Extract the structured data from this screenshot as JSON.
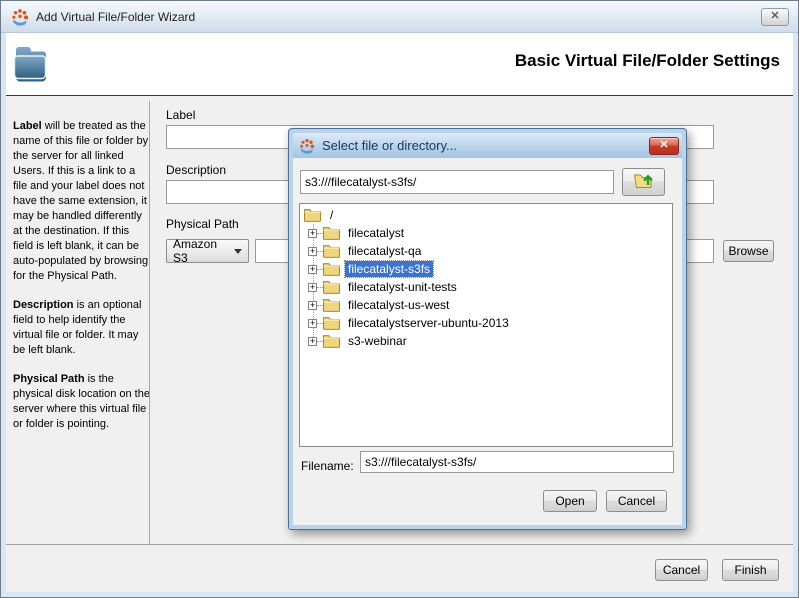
{
  "window": {
    "title": "Add Virtual File/Folder Wizard",
    "close_glyph": "✕"
  },
  "header": {
    "title": "Basic Virtual File/Folder Settings"
  },
  "sidebar": {
    "paragraphs": [
      {
        "lead": "Label",
        "rest": " will be treated as the name of this file or folder by the server for all linked Users. If this is a link to a file and your label does not have the same extension, it may be handled differently at the destination. If this field is left blank, it can be auto-populated by browsing for the Physical Path."
      },
      {
        "lead": "Description",
        "rest": " is an optional field to help identify the virtual file or folder. It may be left blank."
      },
      {
        "lead": "Physical Path",
        "rest": " is the physical disk location on the server where this virtual file or folder is pointing."
      }
    ]
  },
  "form": {
    "label_label": "Label",
    "label_value": "",
    "description_label": "Description",
    "description_value": "",
    "physical_path_label": "Physical Path",
    "storage_type_selected": "Amazon S3",
    "physical_path_value": "",
    "browse_label": "Browse"
  },
  "footer": {
    "cancel_label": "Cancel",
    "finish_label": "Finish"
  },
  "dialog": {
    "title": "Select file or directory...",
    "close_glyph": "✕",
    "path_value": "s3:///filecatalyst-s3fs/",
    "tree": {
      "root": "/",
      "items": [
        {
          "label": "filecatalyst",
          "selected": false
        },
        {
          "label": "filecatalyst-qa",
          "selected": false
        },
        {
          "label": "filecatalyst-s3fs",
          "selected": true
        },
        {
          "label": "filecatalyst-unit-tests",
          "selected": false
        },
        {
          "label": "filecatalyst-us-west",
          "selected": false
        },
        {
          "label": "filecatalystserver-ubuntu-2013",
          "selected": false
        },
        {
          "label": "s3-webinar",
          "selected": false
        }
      ]
    },
    "filename_label": "Filename:",
    "filename_value": "s3:///filecatalyst-s3fs/",
    "open_label": "Open",
    "cancel_label": "Cancel"
  },
  "colors": {
    "selection_bg": "#3b73ce",
    "dialog_frame_blue": "#b9d3ea",
    "close_button_red": "#c53a24",
    "tree_folder_yellow": "#efd57b",
    "header_folder_blue": "#3d7191",
    "logo_orange": "#e8500f",
    "logo_blue": "#5b9bd5"
  }
}
